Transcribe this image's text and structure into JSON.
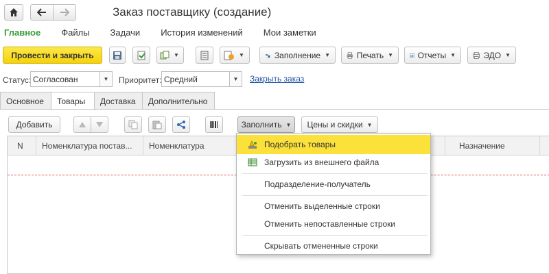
{
  "window": {
    "title": "Заказ поставщику (создание)"
  },
  "nav": {
    "home_icon": "home-icon",
    "back_icon": "arrow-left-icon",
    "forward_icon": "arrow-right-icon"
  },
  "sections": [
    {
      "label": "Главное",
      "active": true
    },
    {
      "label": "Файлы",
      "active": false
    },
    {
      "label": "Задачи",
      "active": false
    },
    {
      "label": "История изменений",
      "active": false
    },
    {
      "label": "Мои заметки",
      "active": false
    }
  ],
  "toolbar": {
    "post_close": "Провести и закрыть",
    "fill": "Заполнение",
    "print": "Печать",
    "reports": "Отчеты",
    "edo": "ЭДО"
  },
  "status_row": {
    "status_label": "Статус:",
    "status_value": "Согласован",
    "priority_label": "Приоритет:",
    "priority_value": "Средний",
    "close_order_link": "Закрыть заказ"
  },
  "tabs": [
    {
      "label": "Основное",
      "active": false
    },
    {
      "label": "Товары",
      "active": true
    },
    {
      "label": "Доставка",
      "active": false
    },
    {
      "label": "Дополнительно",
      "active": false
    }
  ],
  "table_toolbar": {
    "add": "Добавить",
    "fill": "Заполнить",
    "prices": "Цены и скидки"
  },
  "table": {
    "columns": [
      {
        "label": "N"
      },
      {
        "label": "Номенклатура постав..."
      },
      {
        "label": "Номенклатура"
      },
      {
        "label": "Назначение"
      }
    ]
  },
  "fill_menu": {
    "items": [
      {
        "label": "Подобрать товары",
        "icon": "pick-goods-icon",
        "highlighted": true
      },
      {
        "label": "Загрузить из внешнего файла",
        "icon": "load-file-icon",
        "highlighted": false
      },
      {
        "label": "Подразделение-получатель",
        "icon": "",
        "highlighted": false
      },
      {
        "label": "Отменить выделенные строки",
        "icon": "",
        "highlighted": false
      },
      {
        "label": "Отменить непоставленные строки",
        "icon": "",
        "highlighted": false
      },
      {
        "label": "Скрывать отмененные строки",
        "icon": "",
        "highlighted": false
      }
    ]
  },
  "colors": {
    "accent_green": "#3a9d3a",
    "primary_yellow": "#f5d20a",
    "menu_highlight": "#fde13b",
    "link_blue": "#2255a4"
  }
}
